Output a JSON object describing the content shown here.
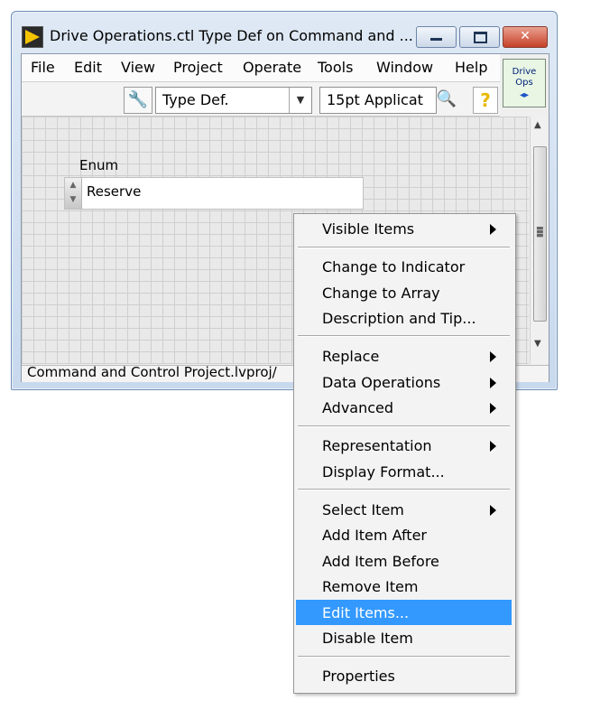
{
  "window": {
    "title": "Drive Operations.ctl Type Def on Command and ...",
    "controls": {
      "minimize": "▭",
      "maximize": "□",
      "close": "✕"
    }
  },
  "menubar": {
    "items": [
      "File",
      "Edit",
      "View",
      "Project",
      "Operate",
      "Tools",
      "Window",
      "Help"
    ]
  },
  "vi_icon": {
    "line1": "Drive",
    "line2": "Ops",
    "arrows": "◂▸"
  },
  "toolbar": {
    "control_type_value": "Type Def.",
    "font_value": "15pt Applicat",
    "icons": [
      "wrench-icon",
      "search-icon",
      "help-icon"
    ],
    "help_glyph": "?"
  },
  "front_panel": {
    "enum_label": "Enum",
    "enum_value": "Reserve"
  },
  "statusbar": {
    "text": "Command and Control Project.lvproj/"
  },
  "context_menu": {
    "highlight_color": "#3399ff",
    "groups": [
      [
        {
          "label": "Visible Items",
          "submenu": true
        }
      ],
      [
        {
          "label": "Change to Indicator",
          "submenu": false
        },
        {
          "label": "Change to Array",
          "submenu": false
        },
        {
          "label": "Description and Tip...",
          "submenu": false
        }
      ],
      [
        {
          "label": "Replace",
          "submenu": true
        },
        {
          "label": "Data Operations",
          "submenu": true
        },
        {
          "label": "Advanced",
          "submenu": true
        }
      ],
      [
        {
          "label": "Representation",
          "submenu": true
        },
        {
          "label": "Display Format...",
          "submenu": false
        }
      ],
      [
        {
          "label": "Select Item",
          "submenu": true
        },
        {
          "label": "Add Item After",
          "submenu": false
        },
        {
          "label": "Add Item Before",
          "submenu": false
        },
        {
          "label": "Remove Item",
          "submenu": false
        },
        {
          "label": "Edit Items...",
          "submenu": false,
          "highlighted": true
        },
        {
          "label": "Disable Item",
          "submenu": false
        }
      ],
      [
        {
          "label": "Properties",
          "submenu": false
        }
      ]
    ]
  }
}
